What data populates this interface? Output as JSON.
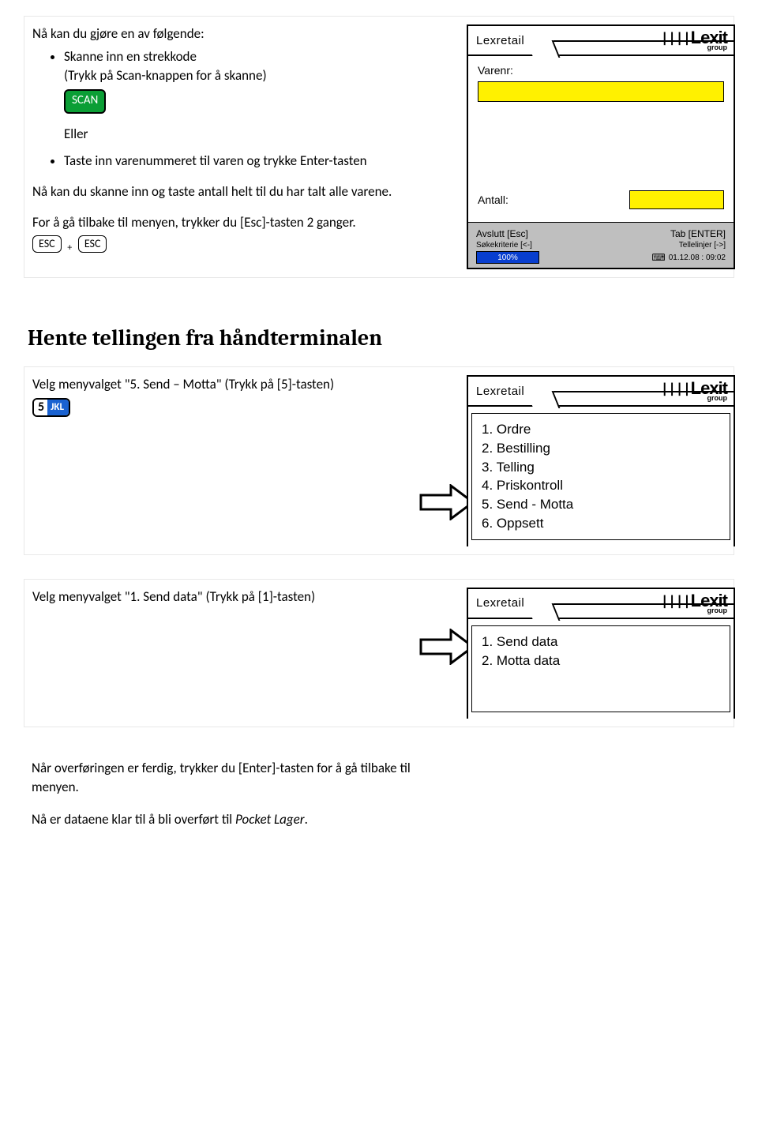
{
  "block1": {
    "intro": "Nå kan du gjøre en av følgende:",
    "item1_line1": "Skanne inn en strekkode",
    "item1_line2": "(Trykk på Scan-knappen for å skanne)",
    "key_scan": "SCAN",
    "eller": "Eller",
    "item2": "Taste inn varenummeret til varen og trykke Enter-tasten",
    "para2": "Nå kan du skanne inn og taste antall helt til du har talt alle varene.",
    "para3": "For å gå tilbake til menyen, trykker du [Esc]-tasten 2 ganger.",
    "esc": "ESC",
    "plus": "+"
  },
  "terminal1": {
    "title": "Lexretail",
    "logo": "Lexit",
    "logo_group": "group",
    "varenr_label": "Varenr:",
    "antall_label": "Antall:",
    "footer": {
      "avslutt": "Avslutt [Esc]",
      "tab": "Tab [ENTER]",
      "sokekrit": "Søkekriterie [<-]",
      "tellelinjer": "Tellelinjer [->]",
      "battery": "100%",
      "timestamp": "01.12.08 : 09:02"
    }
  },
  "section_title": "Hente tellingen fra håndterminalen",
  "block2": {
    "text": "Velg menyvalget \"5. Send – Motta\"  (Trykk på [5]-tasten)",
    "key5_num": "5",
    "key5_lbl": "JKL"
  },
  "terminal2": {
    "title": "Lexretail",
    "menu": [
      "1. Ordre",
      "2. Bestilling",
      "3. Telling",
      "4. Priskontroll",
      "5. Send - Motta",
      "6. Oppsett"
    ]
  },
  "block3": {
    "text": "Velg menyvalget \"1. Send data\" (Trykk på [1]-tasten)"
  },
  "terminal3": {
    "title": "Lexretail",
    "menu": [
      "1. Send data",
      "2. Motta data"
    ]
  },
  "block4": {
    "para1": "Når overføringen er ferdig, trykker du [Enter]-tasten for å gå tilbake til menyen.",
    "para2": "Nå er dataene klar til å bli overført til Pocket Lager."
  },
  "logo": {
    "text": "Lexit",
    "group": "group"
  }
}
